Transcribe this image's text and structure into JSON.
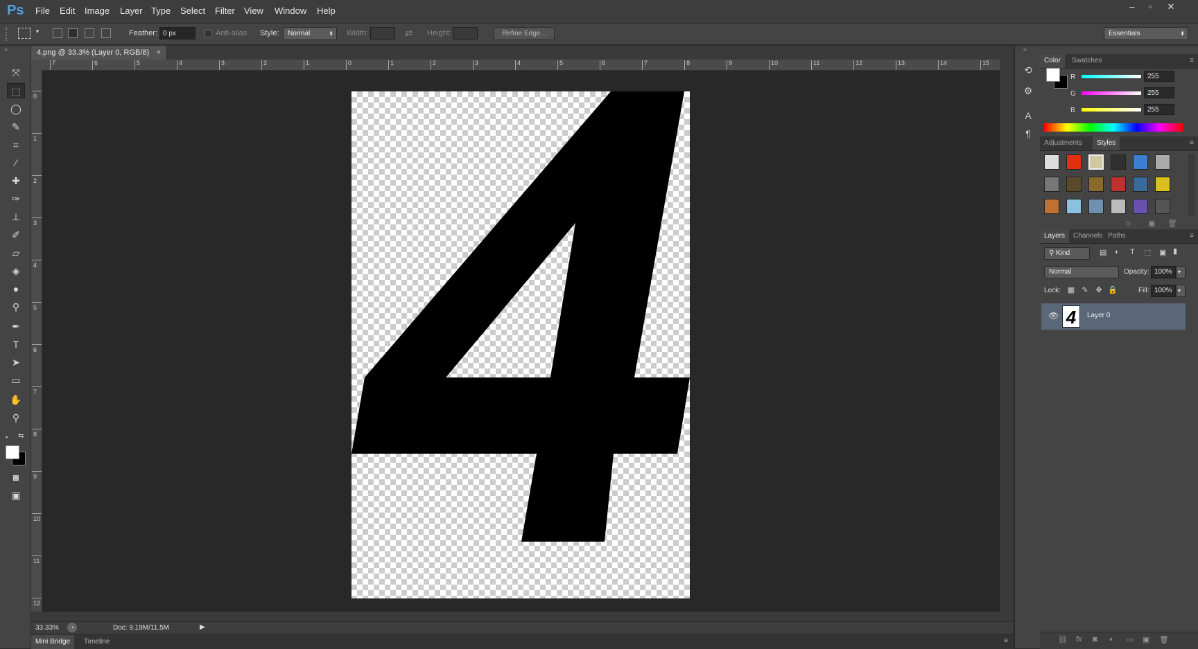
{
  "app": {
    "logo": "Ps"
  },
  "menu": [
    "File",
    "Edit",
    "Image",
    "Layer",
    "Type",
    "Select",
    "Filter",
    "View",
    "Window",
    "Help"
  ],
  "window_controls": [
    "–",
    "▫",
    "✕"
  ],
  "options": {
    "feather_label": "Feather:",
    "feather_value": "0 px",
    "antialias_label": "Anti-alias",
    "style_label": "Style:",
    "style_value": "Normal",
    "width_label": "Width:",
    "height_label": "Height:",
    "refine_edge": "Refine Edge...",
    "workspace": "Essentials"
  },
  "document": {
    "tab_title": "4.png @ 33.3% (Layer 0, RGB/8)",
    "tab_close": "×",
    "glyph": "4",
    "ruler_top": [
      "7",
      "6",
      "5",
      "4",
      "3",
      "2",
      "1",
      "0",
      "1",
      "2",
      "3",
      "4",
      "5",
      "6",
      "7",
      "8",
      "9",
      "10",
      "11",
      "12",
      "13",
      "14",
      "15"
    ],
    "ruler_left": [
      "0",
      "1",
      "2",
      "3",
      "4",
      "5",
      "6",
      "7",
      "8",
      "9",
      "10",
      "11",
      "12"
    ]
  },
  "status": {
    "zoom": "33.33%",
    "doc": "Doc: 9.19M/11.5M"
  },
  "bottom_tabs": [
    "Mini Bridge",
    "Timeline"
  ],
  "color_panel": {
    "tabs": [
      "Color",
      "Swatches"
    ],
    "channels": [
      {
        "label": "R",
        "value": "255"
      },
      {
        "label": "G",
        "value": "255"
      },
      {
        "label": "B",
        "value": "255"
      }
    ],
    "foreground": "#ffffff",
    "background": "#000000"
  },
  "styles_panel": {
    "tabs": [
      "Adjustments",
      "Styles"
    ]
  },
  "layers_panel": {
    "tabs": [
      "Layers",
      "Channels",
      "Paths"
    ],
    "filter": "Kind",
    "blend_mode": "Normal",
    "opacity_label": "Opacity:",
    "opacity_value": "100%",
    "lock_label": "Lock:",
    "fill_label": "Fill:",
    "fill_value": "100%",
    "layers": [
      {
        "name": "Layer 0",
        "thumb": "4",
        "selected": true
      }
    ]
  }
}
